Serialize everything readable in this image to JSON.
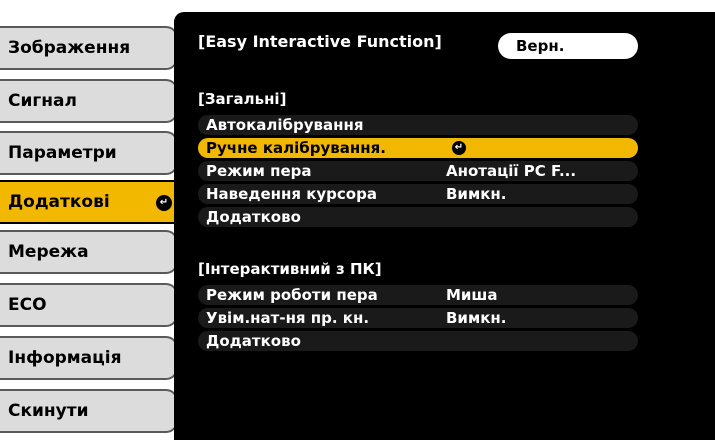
{
  "sidebar": {
    "items": [
      {
        "label": "Зображення"
      },
      {
        "label": "Сигнал"
      },
      {
        "label": "Параметри"
      },
      {
        "label": "Додаткові"
      },
      {
        "label": "Мережа"
      },
      {
        "label": "ECO"
      },
      {
        "label": "Інформація"
      },
      {
        "label": "Скинути"
      }
    ],
    "active_index": 3
  },
  "panel": {
    "title": "[Easy Interactive Function]",
    "back_label": "Верн.",
    "sections": [
      {
        "header": "[Загальні]",
        "rows": [
          {
            "label": "Автокалібрування",
            "value": ""
          },
          {
            "label": "Ручне калібрування.",
            "value": ""
          },
          {
            "label": "Режим пера",
            "value": "Анотації PC F..."
          },
          {
            "label": "Наведення курсора",
            "value": "Вимкн."
          },
          {
            "label": "Додатково",
            "value": ""
          }
        ]
      },
      {
        "header": "[Інтерактивний з ПК]",
        "rows": [
          {
            "label": "Режим роботи пера",
            "value": "Миша"
          },
          {
            "label": "Увім.нат-ня пр. кн.",
            "value": "Вимкн."
          },
          {
            "label": "Додатково",
            "value": ""
          }
        ]
      }
    ]
  },
  "colors": {
    "accent": "#f2b800",
    "panel_bg": "#000000",
    "sidebar_bg": "#dcdcdc"
  },
  "icons": {
    "enter": "enter-icon"
  }
}
